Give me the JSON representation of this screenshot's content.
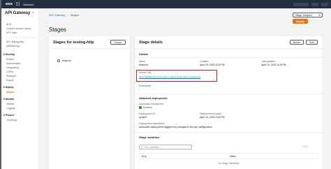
{
  "topnav": {
    "logo": "aws",
    "services_label": "Services"
  },
  "sidebar": {
    "title": "API Gateway",
    "close_glyph": "×",
    "items": [
      "APIs",
      "Custom domain names",
      "VPC links"
    ],
    "api_label": "API: testing-http...",
    "api_id": "(5b5faetr1g)",
    "sections": [
      {
        "label": "Develop",
        "items": [
          "Routes",
          "Authorization",
          "Integrations",
          "CORS",
          "Reimport",
          "Export"
        ]
      },
      {
        "label": "Deploy",
        "items": [
          "Stages"
        ],
        "active": "Stages"
      },
      {
        "label": "Monitor",
        "items": [
          "Metrics",
          "Logging"
        ]
      },
      {
        "label": "Protect",
        "items": [
          "Throttling"
        ]
      }
    ]
  },
  "breadcrumb": {
    "root": "API Gateway",
    "current": "Stages"
  },
  "stage_select": {
    "label": "Stage: testprod",
    "caret": "▼"
  },
  "deploy_button": "Deploy",
  "page_title": "Stages",
  "stages_panel": {
    "title": "Stages for testing-http",
    "create_button": "Create",
    "stages": [
      "testprod"
    ]
  },
  "stage_details": {
    "title": "Stage details",
    "delete_button": "Delete",
    "edit_button": "Edit",
    "details_heading": "Details",
    "name_label": "Name",
    "name_value": "testprod",
    "created_label": "Created",
    "created_value": "April 19, 2023 3:03 PM",
    "updated_label": "Last updated",
    "updated_value": "April 19, 2023 3:03 PM",
    "invoke_label": "Invoke URL",
    "invoke_url": "https://5b5faetr1g.execute-api.us-east-2.amazonaws.com/testprod",
    "description_label": "Description",
    "description_value": "-",
    "attached_heading": "Attached deployment",
    "auto_deploy_label": "Automatic Deployment",
    "auto_deploy_value": "Enabled",
    "deployment_id_label": "Deployment ID",
    "deployment_id_value": "qchyh9",
    "deployment_created_label": "Deployment created",
    "deployment_created_value": "April 19, 2023 3:03 PM",
    "deployment_desc_label": "Deployment description",
    "deployment_desc_value": "Automatic deployment triggered by changes to the Api configuration",
    "variables_heading": "Stage variables",
    "search_placeholder": "Find variables",
    "pager": "< 1 >",
    "col_key": "Key",
    "col_value": "Value",
    "empty_text": "No Stage Variables"
  },
  "colors": {
    "accent": "#ec7211",
    "link": "#0073bb",
    "nav": "#232f3e",
    "highlight": "#c0161b",
    "success": "#1d8102"
  }
}
